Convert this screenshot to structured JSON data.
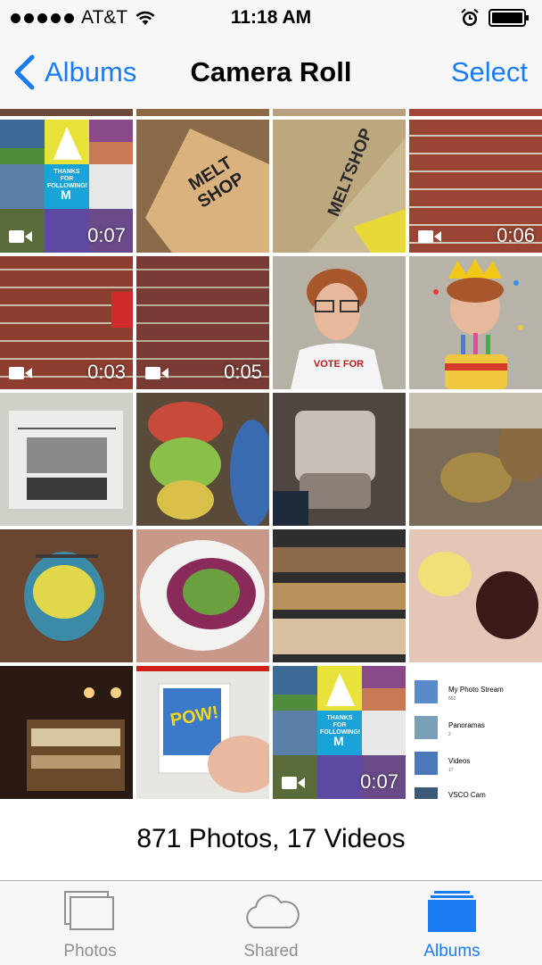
{
  "status_bar": {
    "carrier": "AT&T",
    "time": "11:18 AM"
  },
  "nav": {
    "back_label": "Albums",
    "title": "Camera Roll",
    "select_label": "Select"
  },
  "grid": {
    "videos": [
      {
        "duration": "0:07"
      },
      {
        "duration": "0:06"
      },
      {
        "duration": "0:03"
      },
      {
        "duration": "0:05"
      },
      {
        "duration": "0:07"
      }
    ],
    "photo_texts": {
      "melt_shop": "MELT SHOP",
      "melt_shop_2": "MELTSHOP",
      "thanks": "THANKS FOR FOLLOWING!",
      "m_logo": "M",
      "vote_for": "VOTE FOR",
      "pow": "POW!",
      "albums_list": [
        {
          "name": "My Photo Stream",
          "count": "652"
        },
        {
          "name": "Panoramas",
          "count": "2"
        },
        {
          "name": "Videos",
          "count": "17"
        },
        {
          "name": "VSCO Cam",
          "count": ""
        }
      ]
    }
  },
  "summary": "871 Photos, 17 Videos",
  "tabs": [
    {
      "label": "Photos"
    },
    {
      "label": "Shared"
    },
    {
      "label": "Albums"
    }
  ],
  "colors": {
    "accent": "#1a7cf5",
    "bar_bg": "#f7f7f7",
    "inactive_tab": "#8e8e93"
  }
}
